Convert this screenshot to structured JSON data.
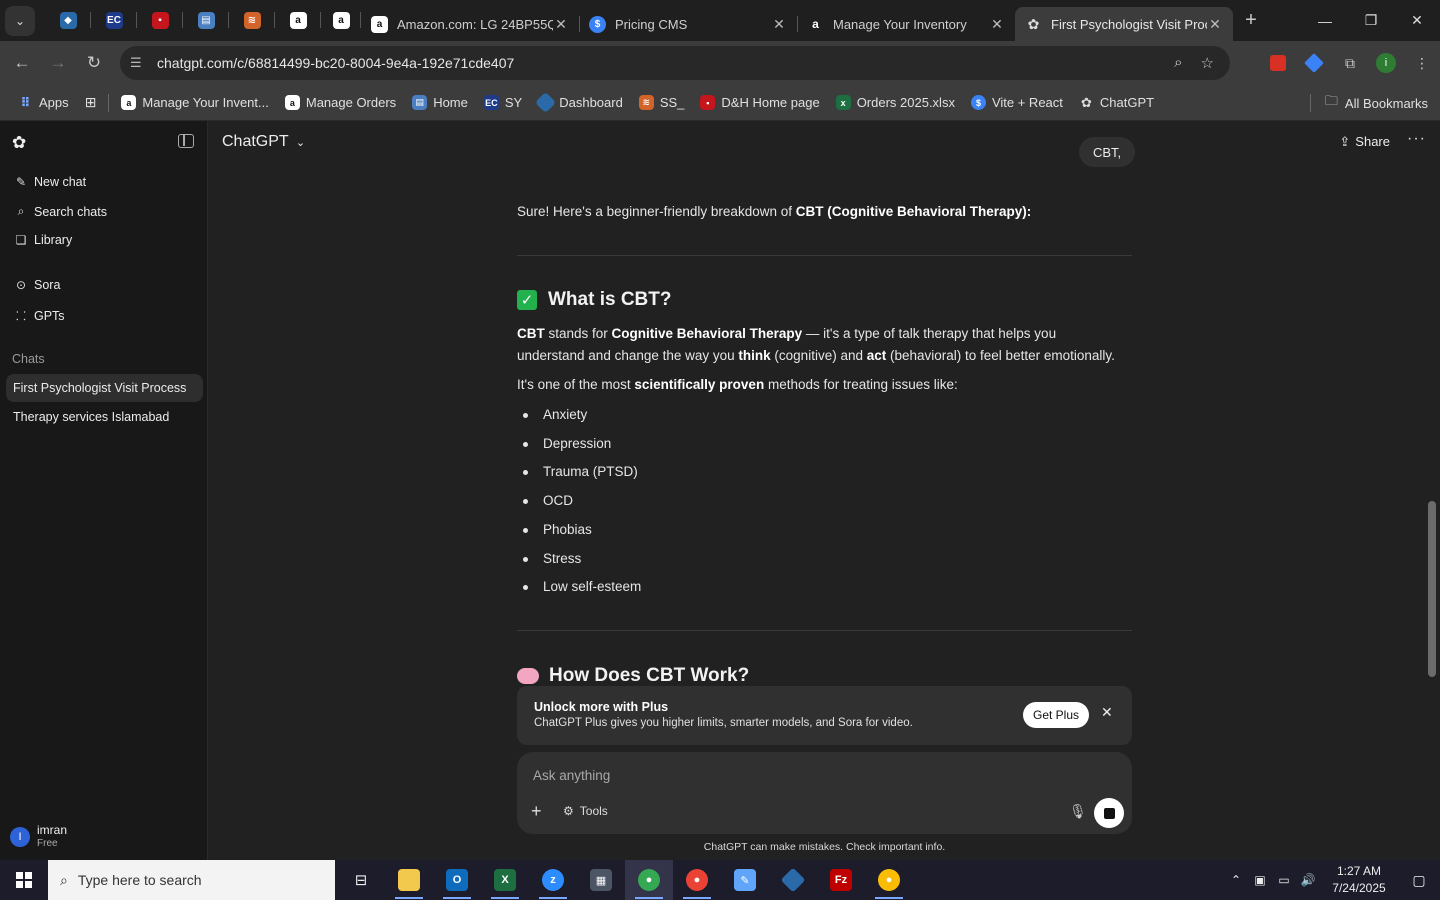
{
  "browser": {
    "tabs": [
      {
        "title": "Amazon.com: LG 24BP55Q",
        "icon": "amazon-icon",
        "active": false
      },
      {
        "title": "Pricing CMS",
        "icon": "dollar-icon",
        "active": false
      },
      {
        "title": "Manage Your Inventory",
        "icon": "amazon-icon",
        "active": false
      },
      {
        "title": "First Psychologist Visit Proc",
        "icon": "chatgpt-icon",
        "active": true
      }
    ],
    "url": "chatgpt.com/c/68814499-bc20-8004-9e4a-192e71cde407",
    "bookmarks": [
      {
        "label": "Apps"
      },
      {
        "label": "Manage Your Invent..."
      },
      {
        "label": "Manage Orders"
      },
      {
        "label": "Home"
      },
      {
        "label": "SY"
      },
      {
        "label": "Dashboard"
      },
      {
        "label": "SS_"
      },
      {
        "label": "D&H Home page"
      },
      {
        "label": "Orders 2025.xlsx"
      },
      {
        "label": "Vite + React"
      },
      {
        "label": "ChatGPT"
      }
    ],
    "all_bookmarks": "All Bookmarks",
    "profile_initial": "i"
  },
  "sidebar": {
    "nav": [
      {
        "label": "New chat",
        "icon": "edit-icon"
      },
      {
        "label": "Search chats",
        "icon": "search-icon"
      },
      {
        "label": "Library",
        "icon": "library-icon"
      },
      {
        "label": "Sora",
        "icon": "play-icon"
      },
      {
        "label": "GPTs",
        "icon": "grid-icon"
      }
    ],
    "chats_label": "Chats",
    "chats": [
      {
        "title": "First Psychologist Visit Process",
        "active": true
      },
      {
        "title": "Therapy services Islamabad",
        "active": false
      }
    ],
    "user": {
      "initial": "I",
      "name": "imran",
      "plan": "Free"
    }
  },
  "header": {
    "model": "ChatGPT",
    "share": "Share"
  },
  "conversation": {
    "user_message": "CBT,",
    "intro_plain": "Sure! Here's a beginner-friendly breakdown of ",
    "intro_bold": "CBT (Cognitive Behavioral Therapy):",
    "h1": "What is CBT?",
    "p1": {
      "b1": "CBT",
      "t1": " stands for ",
      "b2": "Cognitive Behavioral Therapy",
      "t2": " — it's a type of talk therapy that helps you understand and change the way you ",
      "b3": "think",
      "t3": " (cognitive) and ",
      "b4": "act",
      "t4": " (behavioral) to feel better emotionally."
    },
    "p2": {
      "t1": "It's one of the most ",
      "b1": "scientifically proven",
      "t2": " methods for treating issues like:"
    },
    "list": [
      "Anxiety",
      "Depression",
      "Trauma (PTSD)",
      "OCD",
      "Phobias",
      "Stress",
      "Low self-esteem"
    ],
    "h2": "How Does CBT Work?"
  },
  "plus_banner": {
    "title": "Unlock more with Plus",
    "subtitle": "ChatGPT Plus gives you higher limits, smarter models, and Sora for video.",
    "button": "Get Plus"
  },
  "composer": {
    "placeholder": "Ask anything",
    "tools": "Tools"
  },
  "disclaimer": "ChatGPT can make mistakes. Check important info.",
  "taskbar": {
    "search_placeholder": "Type here to search",
    "time": "1:27 AM",
    "date": "7/24/2025"
  }
}
